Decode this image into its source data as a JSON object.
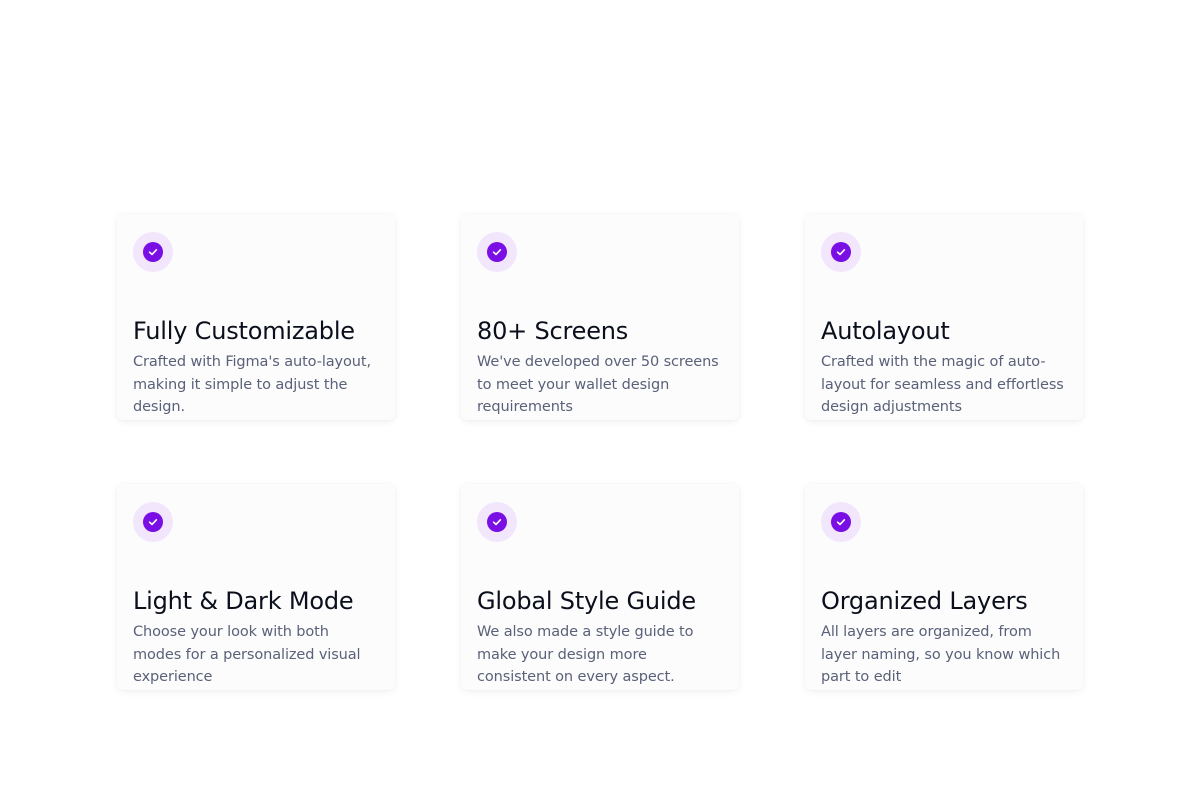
{
  "colors": {
    "accent": "#7A0FE5",
    "accent_soft": "#F1E6FB",
    "title": "#0B0F1C",
    "body": "#5A6178",
    "card_bg": "#FCFCFD"
  },
  "features": [
    {
      "icon": "check-circle-icon",
      "title": "Fully Customizable",
      "description": "Crafted with Figma's auto-layout, making it simple to adjust the design."
    },
    {
      "icon": "check-circle-icon",
      "title": "80+ Screens",
      "description": "We've developed over 50 screens to meet your wallet design requirements"
    },
    {
      "icon": "check-circle-icon",
      "title": "Autolayout",
      "description": "Crafted with the magic of auto-layout for seamless and effortless design adjustments"
    },
    {
      "icon": "check-circle-icon",
      "title": "Light & Dark Mode",
      "description": "Choose your look with both modes for a personalized visual experience"
    },
    {
      "icon": "check-circle-icon",
      "title": "Global Style Guide",
      "description": "We also made a style guide to make your design more consistent on every aspect."
    },
    {
      "icon": "check-circle-icon",
      "title": "Organized Layers",
      "description": "All layers are organized, from layer naming, so you know which part to edit"
    }
  ]
}
